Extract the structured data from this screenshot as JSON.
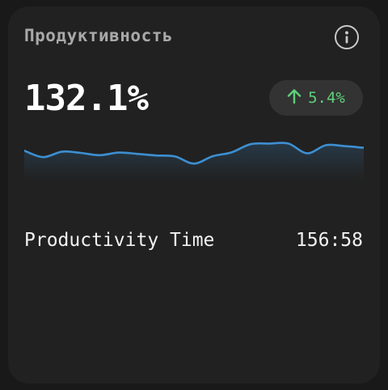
{
  "widget": {
    "title": "Продуктивность",
    "value": "132.1%",
    "change": {
      "text": "5.4%",
      "direction": "up",
      "color": "#5fd07a"
    },
    "info_icon": "info-icon",
    "sparkline": {
      "color": "#3d8fd1",
      "values": [
        0.62,
        0.42,
        0.59,
        0.55,
        0.48,
        0.56,
        0.52,
        0.47,
        0.44,
        0.22,
        0.45,
        0.57,
        0.82,
        0.84,
        0.84,
        0.54,
        0.79,
        0.76,
        0.71
      ]
    },
    "metric": {
      "label": "Productivity Time",
      "value": "156:58"
    }
  }
}
